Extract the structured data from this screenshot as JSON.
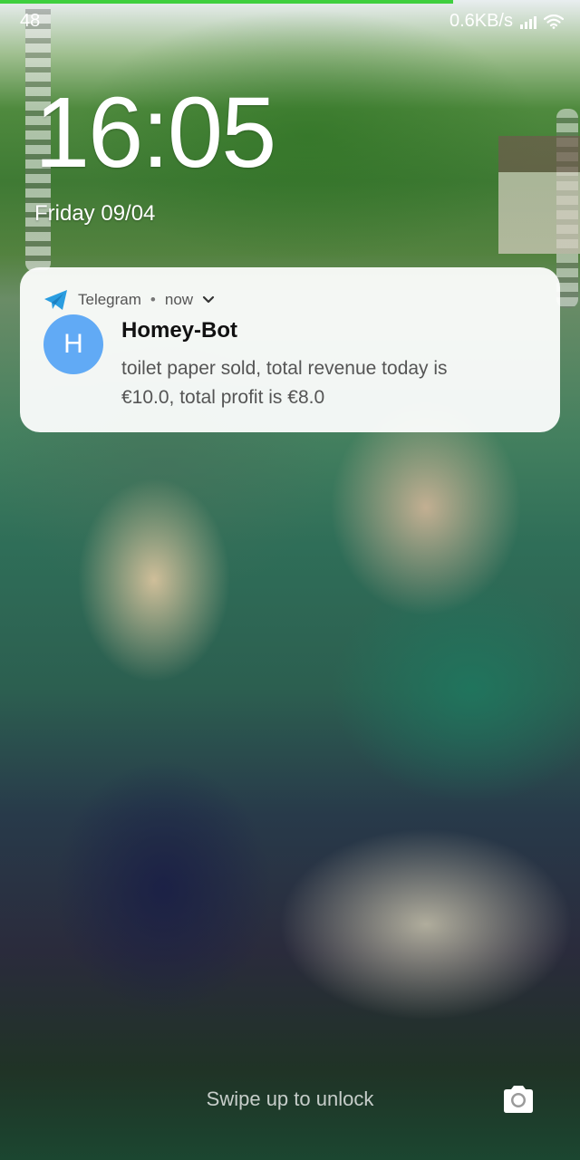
{
  "status_bar": {
    "left_text": "48",
    "speed": "0.6KB/s"
  },
  "lockscreen": {
    "time": "16:05",
    "date": "Friday 09/04",
    "unlock_hint": "Swipe up to unlock"
  },
  "notification": {
    "app_name": "Telegram",
    "separator": "•",
    "time": "now",
    "avatar_letter": "H",
    "title": "Homey-Bot",
    "body": "toilet paper sold, total revenue today is €10.0, total profit is €8.0"
  },
  "colors": {
    "avatar": "#61aaf5",
    "telegram_blue": "#2a9de0",
    "progress_green": "#3fcf3f"
  },
  "icons": {
    "app": "telegram-icon",
    "expand": "chevron-down-icon",
    "signal": "signal-icon",
    "wifi": "wifi-icon",
    "camera": "camera-icon"
  }
}
